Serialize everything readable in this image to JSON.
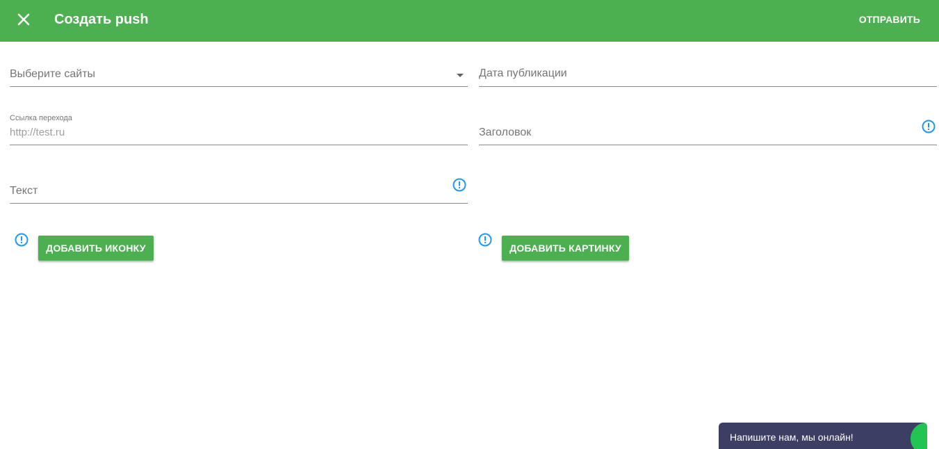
{
  "appbar": {
    "title": "Создать push",
    "send_label": "ОТПРАВИТЬ",
    "close_icon": "close-icon",
    "color": "#4caf50"
  },
  "form": {
    "sites": {
      "placeholder": "Выберите сайты"
    },
    "publish_date": {
      "placeholder": "Дата публикации"
    },
    "link": {
      "label": "Ссылка перехода",
      "value": "http://test.ru"
    },
    "title": {
      "placeholder": "Заголовок"
    },
    "text": {
      "placeholder": "Текст"
    }
  },
  "buttons": {
    "add_icon": "ДОБАВИТЬ ИКОНКУ",
    "add_image": "ДОБАВИТЬ КАРТИНКУ"
  },
  "info_icon": {
    "name": "info-circle-icon",
    "color": "#2196f3"
  },
  "chat": {
    "text": "Напишите нам, мы онлайн!",
    "status_color": "#23c552"
  }
}
